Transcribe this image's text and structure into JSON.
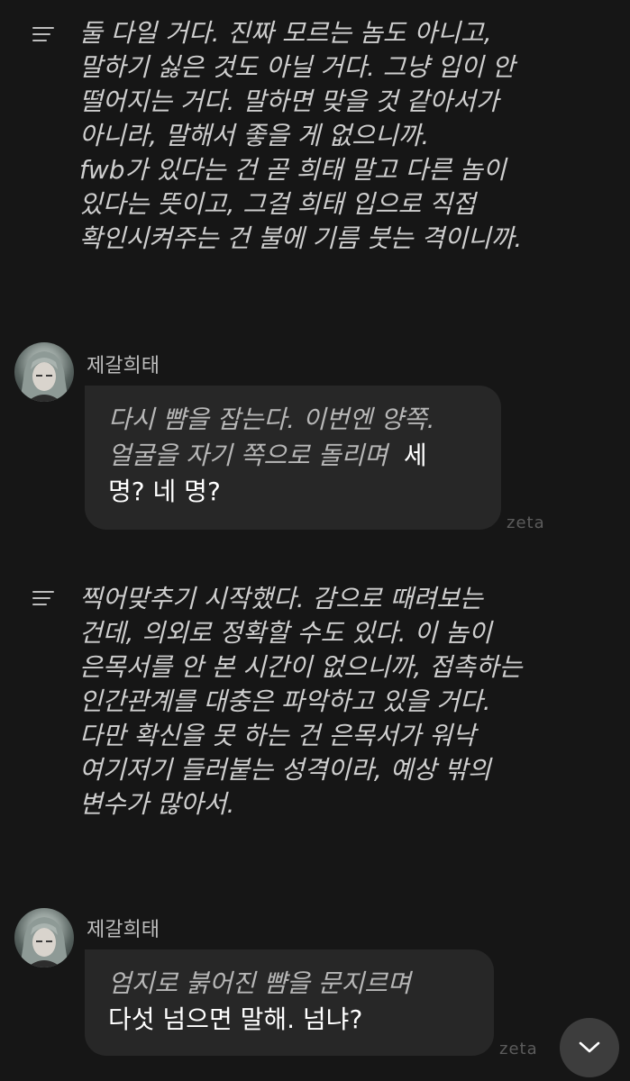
{
  "narration_1": {
    "lines": [
      "둘 다일 거다. 진짜 모르는 놈도 아니고,",
      "말하기 싫은 것도 아닐 거다. 그냥 입이 안",
      "떨어지는 거다. 말하면 맞을 것 같아서가",
      "아니라, 말해서 좋을 게 없으니까.",
      "fwb가 있다는 건 곧 희태 말고 다른 놈이",
      "있다는 뜻이고, 그걸 희태 입으로 직접",
      "확인시켜주는 건 불에 기름 붓는 격이니까."
    ]
  },
  "message_1": {
    "character_name": "제갈희태",
    "action_lines": [
      "다시 뺨을 잡는다. 이번엔 양쪽.",
      "얼굴을 자기 쪽으로 돌리며"
    ],
    "speech_inline": "세",
    "speech_line": "명? 네 명?",
    "brand": "zeta"
  },
  "narration_2": {
    "lines": [
      "찍어맞추기 시작했다. 감으로 때려보는",
      "건데, 의외로 정확할 수도 있다. 이 놈이",
      "은목서를 안 본 시간이 없으니까, 접촉하는",
      "인간관계를 대충은 파악하고 있을 거다.",
      "다만 확신을 못 하는 건 은목서가 워낙",
      "여기저기 들러붙는 성격이라, 예상 밖의",
      "변수가 많아서."
    ]
  },
  "message_2": {
    "character_name": "제갈희태",
    "action_line": "엄지로 붉어진 뺨을 문지르며",
    "speech_line": "다섯 넘으면 말해. 넘냐?",
    "brand": "zeta"
  },
  "icons": {
    "narration": "text-lines-icon",
    "avatar": "character-avatar",
    "scroll_down": "chevron-down-icon"
  }
}
